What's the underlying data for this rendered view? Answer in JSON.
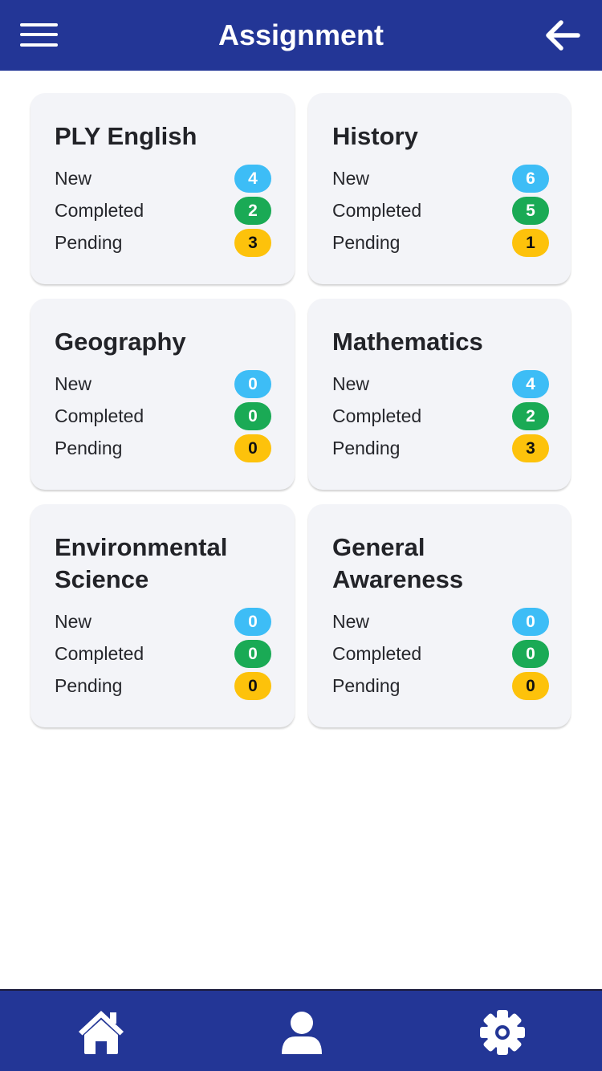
{
  "header": {
    "title": "Assignment",
    "menu_icon": "hamburger-menu-icon",
    "back_icon": "arrow-left-icon",
    "background": "#233696"
  },
  "labels": {
    "new": "New",
    "completed": "Completed",
    "pending": "Pending"
  },
  "subjects": [
    {
      "name": "PLY English",
      "new": "4",
      "completed": "2",
      "pending": "3"
    },
    {
      "name": "History",
      "new": "6",
      "completed": "5",
      "pending": "1"
    },
    {
      "name": "Geography",
      "new": "0",
      "completed": "0",
      "pending": "0"
    },
    {
      "name": "Mathematics",
      "new": "4",
      "completed": "2",
      "pending": "3"
    },
    {
      "name": "Environmental Science",
      "new": "0",
      "completed": "0",
      "pending": "0"
    },
    {
      "name": "General Awareness",
      "new": "0",
      "completed": "0",
      "pending": "0"
    }
  ],
  "colors": {
    "new": "#3dbdf6",
    "completed": "#1aaa55",
    "pending": "#fdc20b",
    "card_bg": "#f3f4f8"
  },
  "bottom_nav": {
    "items": [
      {
        "icon": "home-icon"
      },
      {
        "icon": "user-profile-icon"
      },
      {
        "icon": "settings-gear-icon"
      }
    ]
  }
}
